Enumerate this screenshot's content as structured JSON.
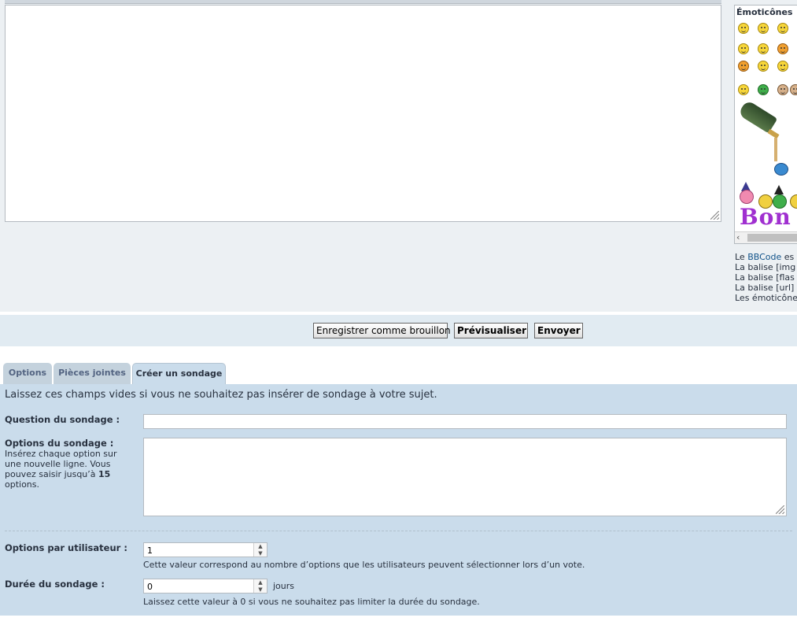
{
  "smilies": {
    "title": "Émoticônes",
    "bon_text": "Bon a"
  },
  "bbcode": {
    "line1_prefix": "Le ",
    "line1_link": "BBCode",
    "line1_suffix": " es",
    "line2": "La balise [img",
    "line3": "La balise [flas",
    "line4": "La balise [url]",
    "line5": "Les émoticône"
  },
  "buttons": {
    "draft": "Enregistrer comme brouillon",
    "preview": "Prévisualiser",
    "submit": "Envoyer"
  },
  "tabs": {
    "options": "Options",
    "attachments": "Pièces jointes",
    "poll": "Créer un sondage"
  },
  "poll": {
    "intro": "Laissez ces champs vides si vous ne souhaitez pas insérer de sondage à votre sujet.",
    "question_label": "Question du sondage :",
    "question_value": "",
    "options_label": "Options du sondage :",
    "options_explain_1": "Insérez chaque option sur une nouvelle ligne. Vous pouvez saisir jusqu’à ",
    "options_explain_max": "15",
    "options_explain_2": " options.",
    "options_value": "",
    "per_user_label": "Options par utilisateur :",
    "per_user_value": "1",
    "per_user_explain": "Cette valeur correspond au nombre d’options que les utilisateurs peuvent sélectionner lors d’un vote.",
    "duration_label": "Durée du sondage :",
    "duration_value": "0",
    "duration_unit": "jours",
    "duration_explain": "Laissez cette valeur à 0 si vous ne souhaitez pas limiter la durée du sondage."
  }
}
